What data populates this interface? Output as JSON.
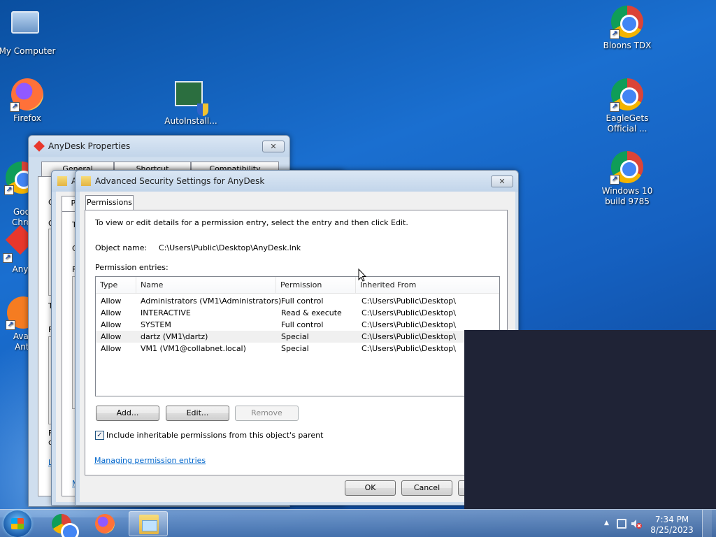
{
  "desktop": {
    "icons_left": [
      {
        "label": "My Computer",
        "icon": "computer-icon"
      },
      {
        "label": "Firefox",
        "icon": "firefox-icon"
      },
      {
        "label": "Goo\nChro",
        "icon": "chrome-icon"
      },
      {
        "label": "Any",
        "icon": "anydesk-icon"
      },
      {
        "label": "Avas\nAnti",
        "icon": "avast-icon"
      }
    ],
    "icon_autoinstall": {
      "label": "AutoInstall...",
      "icon": "installer-icon"
    },
    "icons_right": [
      {
        "label": "Bloons TDX",
        "icon": "chrome-icon"
      },
      {
        "label": "EagleGets\nOfficial ...",
        "icon": "chrome-icon"
      },
      {
        "label": "Windows 10\nbuild 9785",
        "icon": "chrome-icon"
      }
    ]
  },
  "anydesk_props": {
    "title": "AnyDesk Properties",
    "close": "✕",
    "tabs": [
      "General",
      "Shortcut",
      "Compatibility"
    ],
    "left_fragments": [
      "C",
      "G",
      "T",
      "F",
      "F\nc",
      "L"
    ]
  },
  "security_win": {
    "title_frag": "A",
    "tab_frag": "Pe",
    "fragments": [
      "T",
      "C",
      "F",
      "M"
    ]
  },
  "adv": {
    "title": "Advanced Security Settings for AnyDesk",
    "close": "✕",
    "tab": "Permissions",
    "instructions": "To view or edit details for a permission entry, select the entry and then click Edit.",
    "object_name_label": "Object name:",
    "object_name": "C:\\Users\\Public\\Desktop\\AnyDesk.lnk",
    "entries_label": "Permission entries:",
    "columns": [
      "Type",
      "Name",
      "Permission",
      "Inherited From"
    ],
    "rows": [
      {
        "type": "Allow",
        "name": "Administrators (VM1\\Administrators)",
        "permission": "Full control",
        "inherited": "C:\\Users\\Public\\Desktop\\"
      },
      {
        "type": "Allow",
        "name": "INTERACTIVE",
        "permission": "Read & execute",
        "inherited": "C:\\Users\\Public\\Desktop\\"
      },
      {
        "type": "Allow",
        "name": "SYSTEM",
        "permission": "Full control",
        "inherited": "C:\\Users\\Public\\Desktop\\"
      },
      {
        "type": "Allow",
        "name": "dartz (VM1\\dartz)",
        "permission": "Special",
        "inherited": "C:\\Users\\Public\\Desktop\\"
      },
      {
        "type": "Allow",
        "name": "VM1 (VM1@collabnet.local)",
        "permission": "Special",
        "inherited": "C:\\Users\\Public\\Desktop\\"
      }
    ],
    "add": "Add...",
    "edit": "Edit...",
    "remove": "Remove",
    "include_checkbox": "Include inheritable permissions from this object's parent",
    "include_checked": "✓",
    "manage_link": "Managing permission entries",
    "ok": "OK",
    "cancel": "Cancel"
  },
  "taskbar": {
    "time": "7:34 PM",
    "date": "8/25/2023",
    "tray_up": "▲"
  }
}
